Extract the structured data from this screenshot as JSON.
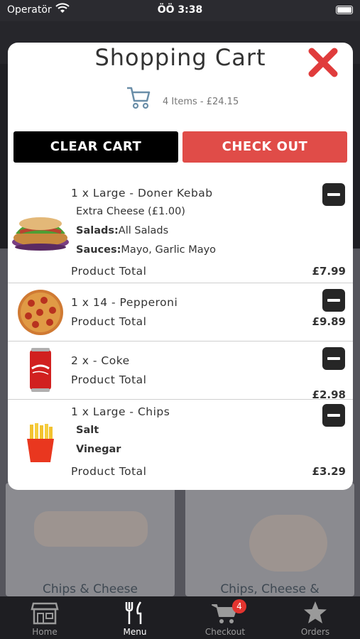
{
  "status_bar": {
    "carrier": "Operatör",
    "time": "ÖÖ 3:38"
  },
  "background": {
    "card_left_title": "Chips & Cheese",
    "card_right_title": "Chips, Cheese &"
  },
  "cart": {
    "title": "Shopping Cart",
    "summary": "4 Items - £24.15",
    "clear_label": "CLEAR CART",
    "checkout_label": "CHECK OUT",
    "items": [
      {
        "name": "1 x Large - Doner Kebab",
        "options": [
          "Extra Cheese (£1.00)"
        ],
        "salads_label": "Salads:",
        "salads": "All Salads",
        "sauces_label": "Sauces:",
        "sauces": "Mayo, Garlic Mayo",
        "total_label": "Product Total",
        "price": "£7.99",
        "image_icon": "kebab-image"
      },
      {
        "name": "1 x 14 - Pepperoni",
        "total_label": "Product Total",
        "price": "£9.89",
        "image_icon": "pizza-image"
      },
      {
        "name": "2 x - Coke",
        "total_label": "Product Total",
        "price": "£2.98",
        "image_icon": "coke-can-image"
      },
      {
        "name": "1 x Large - Chips",
        "options": [
          "Salt",
          "Vinegar"
        ],
        "total_label": "Product Total",
        "price": "£3.29",
        "image_icon": "chips-image"
      }
    ]
  },
  "tabbar": {
    "tabs": [
      {
        "label": "Home",
        "icon": "store-icon"
      },
      {
        "label": "Menu",
        "icon": "fork-knife-icon",
        "active": true
      },
      {
        "label": "Checkout",
        "icon": "cart-icon",
        "badge": "4"
      },
      {
        "label": "Orders",
        "icon": "star-icon"
      }
    ]
  },
  "colors": {
    "accent_red": "#e04c48",
    "close_red": "#e03c3c",
    "dark": "#000000"
  }
}
